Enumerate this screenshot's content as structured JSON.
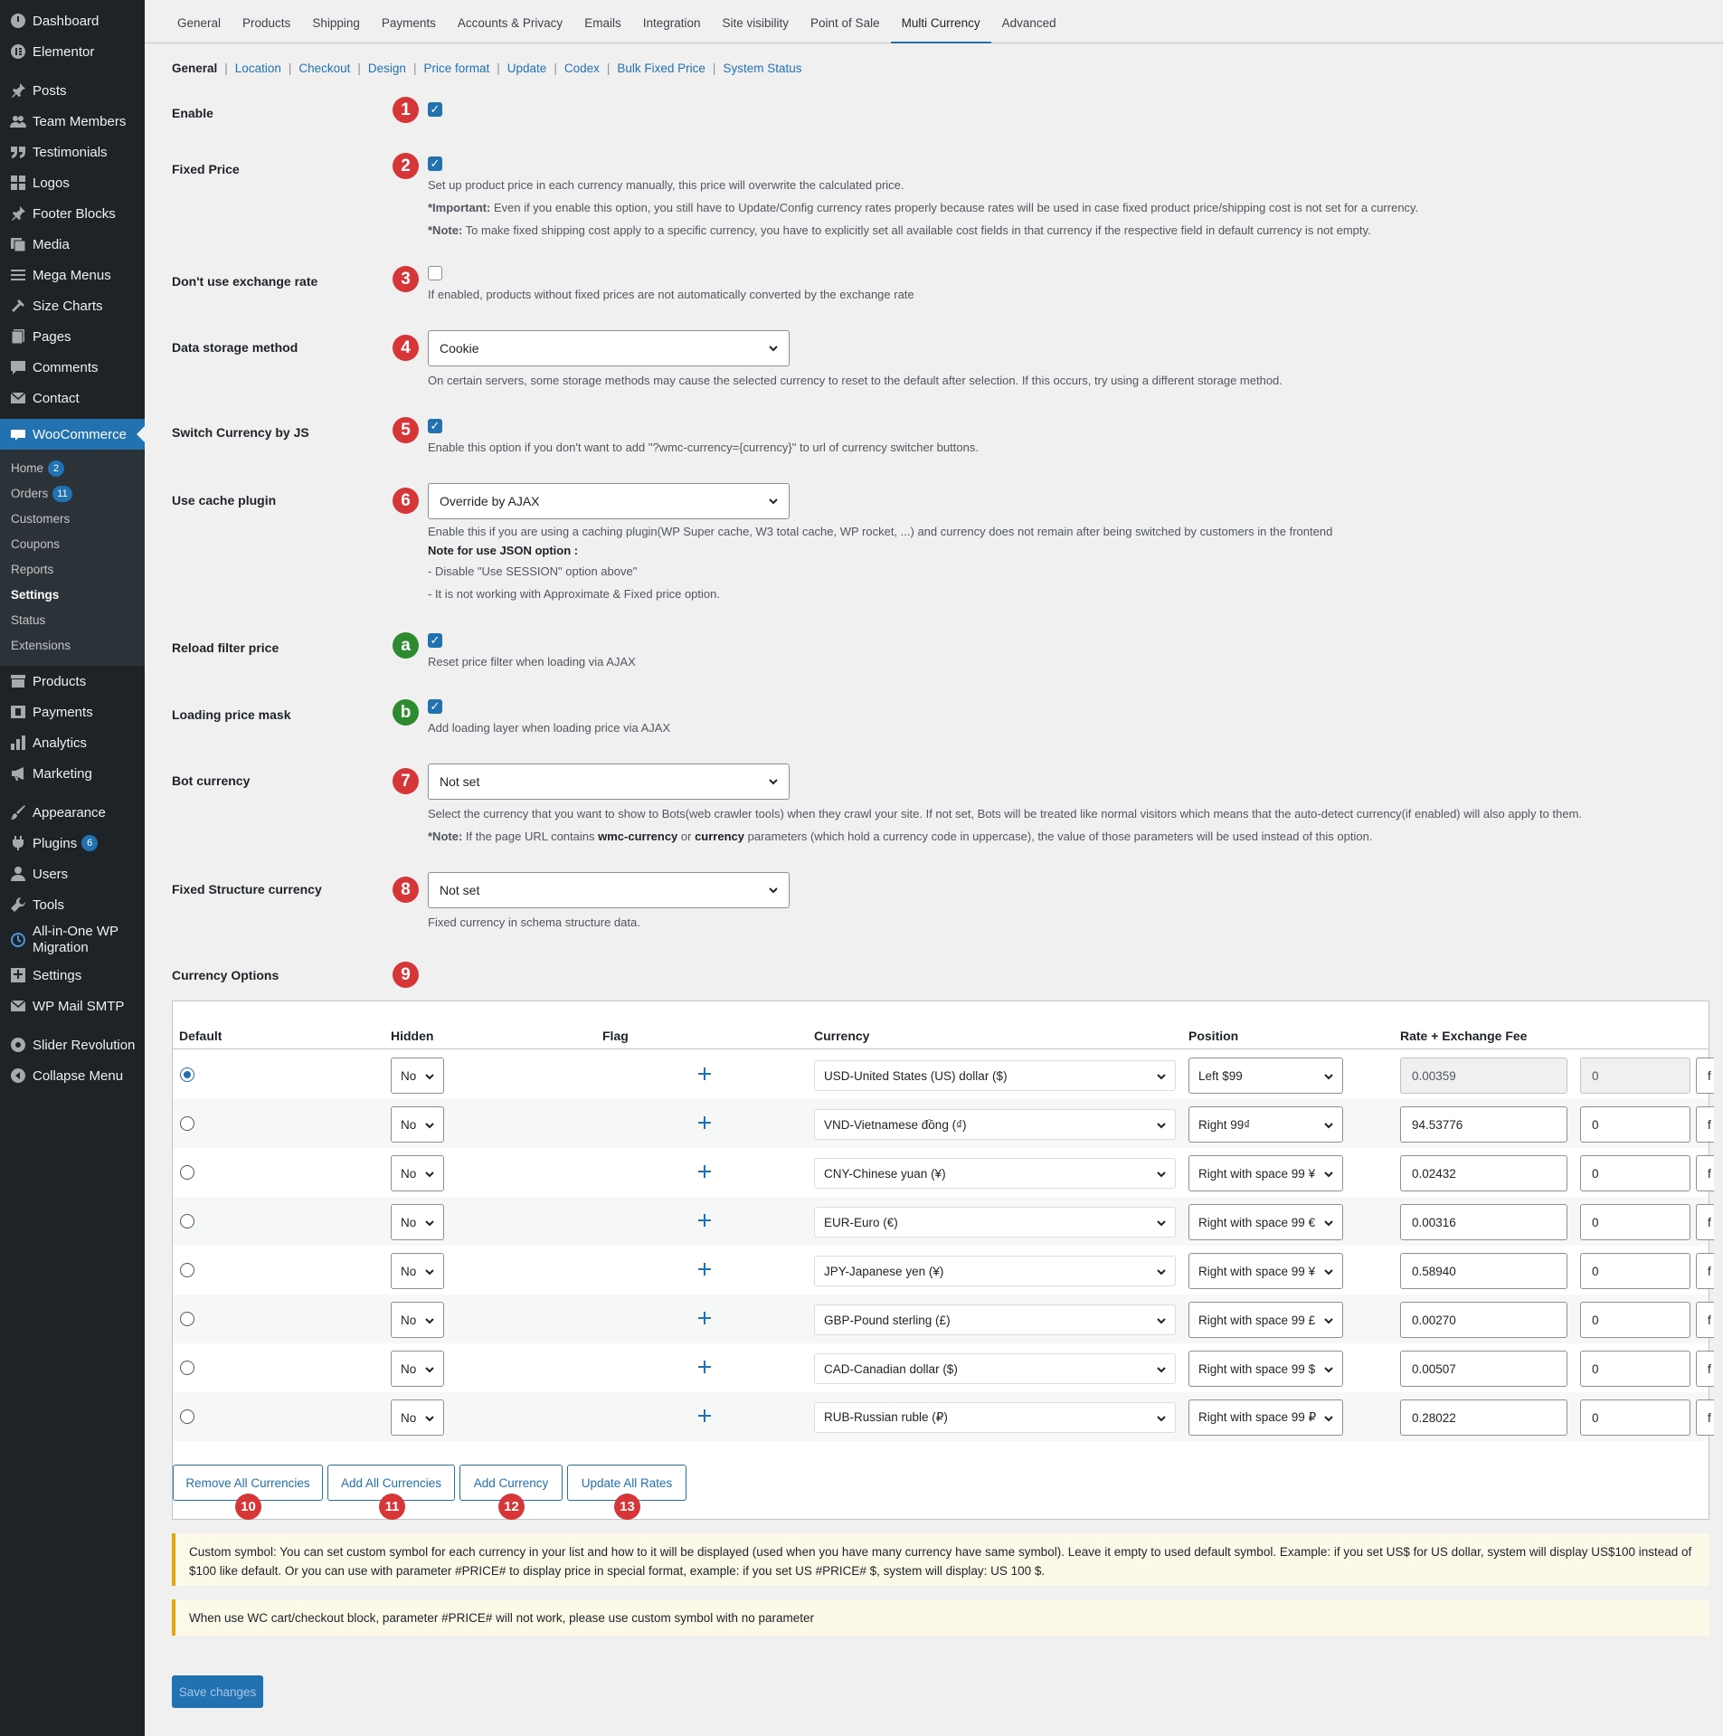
{
  "sidebar": {
    "items": [
      {
        "label": "Dashboard",
        "icon": "dashboard-icon"
      },
      {
        "label": "Elementor",
        "icon": "elementor-icon"
      },
      {
        "label": "Posts",
        "icon": "pin-icon"
      },
      {
        "label": "Team Members",
        "icon": "users-icon"
      },
      {
        "label": "Testimonials",
        "icon": "quote-icon"
      },
      {
        "label": "Logos",
        "icon": "grid-icon"
      },
      {
        "label": "Footer Blocks",
        "icon": "pin-icon"
      },
      {
        "label": "Media",
        "icon": "media-icon"
      },
      {
        "label": "Mega Menus",
        "icon": "menu-icon"
      },
      {
        "label": "Size Charts",
        "icon": "tools-icon"
      },
      {
        "label": "Pages",
        "icon": "pages-icon"
      },
      {
        "label": "Comments",
        "icon": "comment-icon"
      },
      {
        "label": "Contact",
        "icon": "mail-icon"
      }
    ],
    "woocommerce": {
      "label": "WooCommerce",
      "icon": "woo-icon"
    },
    "woo_sub": [
      {
        "label": "Home",
        "badge": "2"
      },
      {
        "label": "Orders",
        "badge": "11"
      },
      {
        "label": "Customers"
      },
      {
        "label": "Coupons"
      },
      {
        "label": "Reports"
      },
      {
        "label": "Settings"
      },
      {
        "label": "Status"
      },
      {
        "label": "Extensions"
      }
    ],
    "items2": [
      {
        "label": "Products",
        "icon": "archive-icon"
      },
      {
        "label": "Payments",
        "icon": "payments-icon"
      },
      {
        "label": "Analytics",
        "icon": "chart-icon"
      },
      {
        "label": "Marketing",
        "icon": "megaphone-icon"
      }
    ],
    "items3": [
      {
        "label": "Appearance",
        "icon": "brush-icon"
      },
      {
        "label": "Plugins",
        "icon": "plugin-icon",
        "badge": "6"
      },
      {
        "label": "Users",
        "icon": "user-icon"
      },
      {
        "label": "Tools",
        "icon": "wrench-icon"
      },
      {
        "label": "All-in-One WP Migration",
        "icon": "migration-icon"
      },
      {
        "label": "Settings",
        "icon": "settings-icon"
      },
      {
        "label": "WP Mail SMTP",
        "icon": "mail-icon"
      }
    ],
    "items4": [
      {
        "label": "Slider Revolution",
        "icon": "revolution-icon"
      },
      {
        "label": "Collapse Menu",
        "icon": "collapse-icon"
      }
    ]
  },
  "tabs": [
    "General",
    "Products",
    "Shipping",
    "Payments",
    "Accounts & Privacy",
    "Emails",
    "Integration",
    "Site visibility",
    "Point of Sale",
    "Multi Currency",
    "Advanced"
  ],
  "subtabs": [
    "General",
    "Location",
    "Checkout",
    "Design",
    "Price format",
    "Update",
    "Codex",
    "Bulk Fixed Price",
    "System Status"
  ],
  "settings": {
    "enable": {
      "label": "Enable",
      "marker": "1",
      "checked": true
    },
    "fixed_price": {
      "label": "Fixed Price",
      "marker": "2",
      "checked": true,
      "desc1": "Set up product price in each currency manually, this price will overwrite the calculated price.",
      "imp_b": "*Important:",
      "imp": " Even if you enable this option, you still have to Update/Config currency rates properly because rates will be used in case fixed product price/shipping cost is not set for a currency.",
      "note_b": "*Note:",
      "note": " To make fixed shipping cost apply to a specific currency, you have to explicitly set all available cost fields in that currency if the respective field in default currency is not empty."
    },
    "no_exchange": {
      "label": "Don't use exchange rate",
      "marker": "3",
      "checked": false,
      "desc": "If enabled, products without fixed prices are not automatically converted by the exchange rate"
    },
    "storage": {
      "label": "Data storage method",
      "marker": "4",
      "value": "Cookie",
      "desc": "On certain servers, some storage methods may cause the selected currency to reset to the default after selection. If this occurs, try using a different storage method."
    },
    "switch_js": {
      "label": "Switch Currency by JS",
      "marker": "5",
      "checked": true,
      "desc": "Enable this option if you don't want to add \"?wmc-currency={currency}\" to url of currency switcher buttons."
    },
    "cache": {
      "label": "Use cache plugin",
      "marker": "6",
      "value": "Override by AJAX",
      "desc": "Enable this if you are using a caching plugin(WP Super cache, W3 total cache, WP rocket, ...) and currency does not remain after being switched by customers in the frontend",
      "note_title": "Note for use JSON option :",
      "note1": "- Disable \"Use SESSION\" option above\"",
      "note2": "- It is not working with Approximate & Fixed price option."
    },
    "reload_filter": {
      "label": "Reload filter price",
      "marker": "a",
      "checked": true,
      "desc": "Reset price filter when loading via AJAX"
    },
    "loading_mask": {
      "label": "Loading price mask",
      "marker": "b",
      "checked": true,
      "desc": "Add loading layer when loading price via AJAX"
    },
    "bot": {
      "label": "Bot currency",
      "marker": "7",
      "value": "Not set",
      "desc": "Select the currency that you want to show to Bots(web crawler tools) when they crawl your site. If not set, Bots will be treated like normal visitors which means that the auto-detect currency(if enabled) will also apply to them.",
      "note_b": "*Note:",
      "note_a": " If the page URL contains ",
      "note_p1": "wmc-currency",
      "note_or": " or ",
      "note_p2": "currency",
      "note_c": " parameters (which hold a currency code in uppercase), the value of those parameters will be used instead of this option."
    },
    "structure": {
      "label": "Fixed Structure currency",
      "marker": "8",
      "value": "Not set",
      "desc": "Fixed currency in schema structure data."
    },
    "currency_options": {
      "label": "Currency Options",
      "marker": "9"
    }
  },
  "table": {
    "headers": {
      "default": "Default",
      "hidden": "Hidden",
      "flag": "Flag",
      "currency": "Currency",
      "position": "Position",
      "rate": "Rate + Exchange Fee"
    },
    "rows": [
      {
        "default": true,
        "hidden": "No",
        "currency": "USD-United States (US) dollar ($)",
        "position": "Left $99",
        "rate": "0.00359",
        "fee": "0",
        "extra": "f"
      },
      {
        "default": false,
        "hidden": "No",
        "currency": "VND-Vietnamese đồng (₫)",
        "position": "Right 99₫",
        "rate": "94.53776",
        "fee": "0",
        "extra": "f"
      },
      {
        "default": false,
        "hidden": "No",
        "currency": "CNY-Chinese yuan (¥)",
        "position": "Right with space 99 ¥",
        "rate": "0.02432",
        "fee": "0",
        "extra": "f"
      },
      {
        "default": false,
        "hidden": "No",
        "currency": "EUR-Euro (€)",
        "position": "Right with space 99 €",
        "rate": "0.00316",
        "fee": "0",
        "extra": "f"
      },
      {
        "default": false,
        "hidden": "No",
        "currency": "JPY-Japanese yen (¥)",
        "position": "Right with space 99 ¥",
        "rate": "0.58940",
        "fee": "0",
        "extra": "f"
      },
      {
        "default": false,
        "hidden": "No",
        "currency": "GBP-Pound sterling (£)",
        "position": "Right with space 99 £",
        "rate": "0.00270",
        "fee": "0",
        "extra": "f"
      },
      {
        "default": false,
        "hidden": "No",
        "currency": "CAD-Canadian dollar ($)",
        "position": "Right with space 99 $",
        "rate": "0.00507",
        "fee": "0",
        "extra": "f"
      },
      {
        "default": false,
        "hidden": "No",
        "currency": "RUB-Russian ruble (₽)",
        "position": "Right with space 99 ₽",
        "rate": "0.28022",
        "fee": "0",
        "extra": "f"
      }
    ],
    "buttons": [
      {
        "label": "Remove All Currencies",
        "marker": "10"
      },
      {
        "label": "Add All Currencies",
        "marker": "11"
      },
      {
        "label": "Add Currency",
        "marker": "12"
      },
      {
        "label": "Update All Rates",
        "marker": "13"
      }
    ]
  },
  "notices": {
    "custom_symbol": "Custom symbol: You can set custom symbol for each currency in your list and how to it will be displayed (used when you have many currency have same symbol). Leave it empty to used default symbol. Example: if you set US$ for US dollar, system will display US$100 instead of $100 like default. Or you can use with parameter #PRICE# to display price in special format, example: if you set US #PRICE# $, system will display: US 100 $.",
    "wc_block": "When use WC cart/checkout block, parameter #PRICE# will not work, please use custom symbol with no parameter"
  },
  "save_label": "Save changes",
  "colors": {
    "accent": "#2271b1",
    "marker_red": "#d63638",
    "marker_green": "#2e8a2e",
    "sidebar_bg": "#1d2327"
  }
}
